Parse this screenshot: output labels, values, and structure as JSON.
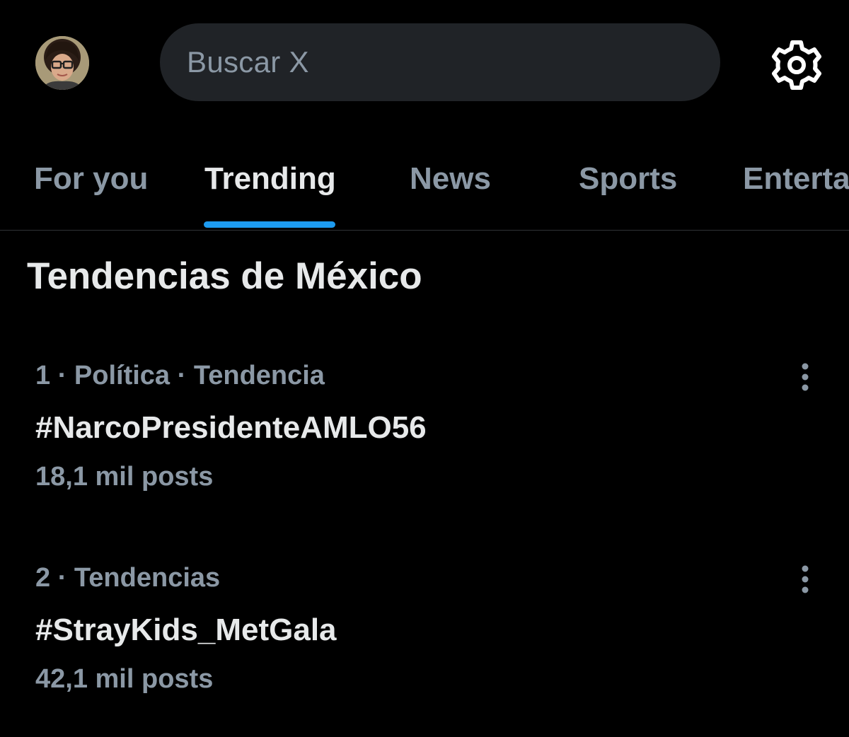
{
  "header": {
    "avatar_icon": "user-avatar",
    "search": {
      "placeholder": "Buscar X",
      "icon": "search-field"
    },
    "settings_icon": "gear-icon"
  },
  "tabs": [
    {
      "label": "For you",
      "active": false
    },
    {
      "label": "Trending",
      "active": true
    },
    {
      "label": "News",
      "active": false
    },
    {
      "label": "Sports",
      "active": false
    },
    {
      "label": "Entertainment",
      "active": false
    }
  ],
  "section": {
    "title": "Tendencias de México"
  },
  "trends": [
    {
      "meta": "1 · Política · Tendencia",
      "name": "#NarcoPresidenteAMLO56",
      "count": "18,1 mil posts",
      "menu_icon": "more-vertical-icon"
    },
    {
      "meta": "2 · Tendencias",
      "name": "#StrayKids_MetGala",
      "count": "42,1 mil posts",
      "menu_icon": "more-vertical-icon"
    }
  ],
  "colors": {
    "background": "#000000",
    "primary_text": "#e7e9ea",
    "secondary_text": "#8b98a5",
    "search_bg": "#202327",
    "accent": "#1d9bf0",
    "divider": "#2f3336"
  }
}
